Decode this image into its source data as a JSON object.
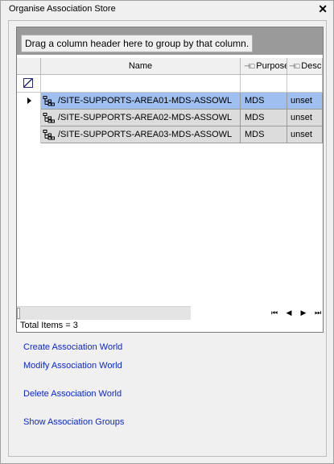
{
  "window": {
    "title": "Organise Association Store",
    "close_glyph": "✕"
  },
  "grid": {
    "group_hint": "Drag a column header here to group by that column.",
    "columns": {
      "name": "Name",
      "purpose": "Purpose",
      "description": "Descript"
    },
    "rows": [
      {
        "name": "/SITE-SUPPORTS-AREA01-MDS-ASSOWL",
        "purpose": "MDS",
        "description": "unset",
        "selected": true
      },
      {
        "name": "/SITE-SUPPORTS-AREA02-MDS-ASSOWL",
        "purpose": "MDS",
        "description": "unset",
        "selected": false
      },
      {
        "name": "/SITE-SUPPORTS-AREA03-MDS-ASSOWL",
        "purpose": "MDS",
        "description": "unset",
        "selected": false
      }
    ],
    "total_label": "Total Items = 3",
    "nav": {
      "first": "⏮",
      "prev": "◀",
      "next": "▶",
      "last": "⏭"
    }
  },
  "links": {
    "create": "Create Association World",
    "modify": "Modify Association World",
    "delete": "Delete Association World",
    "groups": "Show Association Groups"
  },
  "colors": {
    "selection": "#9ebff0",
    "link": "#0a26d8",
    "group_panel": "#9a9a9a"
  },
  "icons": {
    "row": "tree-hierarchy-icon",
    "filter": "filter-icon",
    "pin": "pin-icon"
  }
}
